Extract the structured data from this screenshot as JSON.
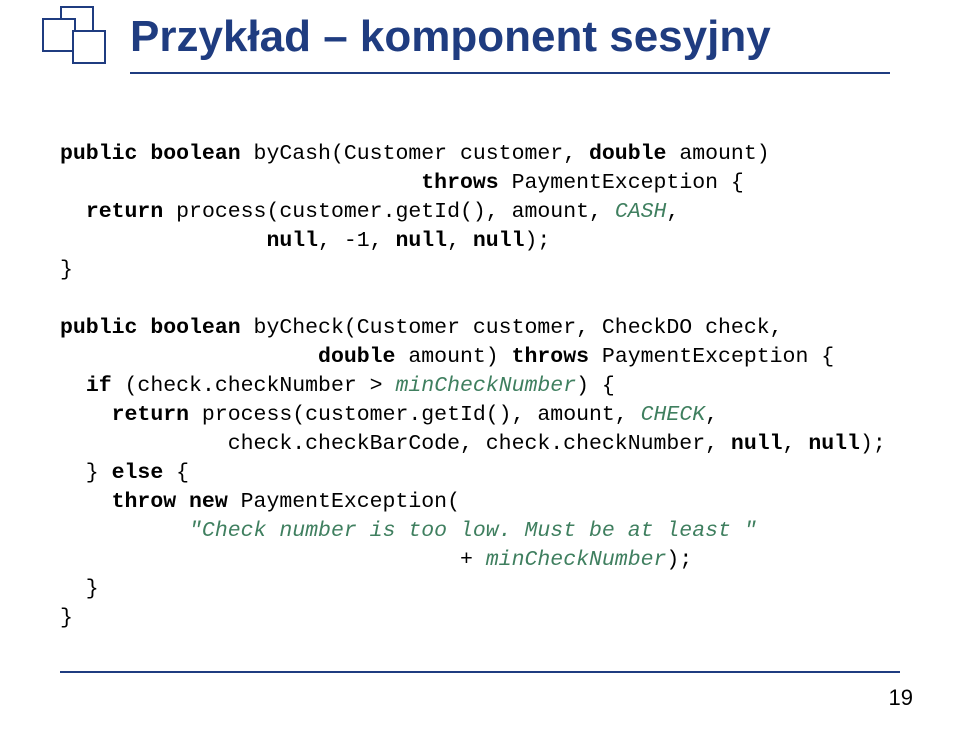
{
  "title": "Przykład – komponent sesyjny",
  "page_number": "19",
  "code": {
    "l1_a": "public boolean",
    "l1_b": " byCash(Customer customer, ",
    "l1_c": "double",
    "l1_d": " amount)",
    "l2_a": "                            ",
    "l2_b": "throws",
    "l2_c": " PaymentException {",
    "l3_a": "  ",
    "l3_b": "return",
    "l3_c": " process(customer.getId(), amount, ",
    "l3_d": "CASH",
    "l3_e": ",",
    "l4_a": "                ",
    "l4_b": "null",
    "l4_c": ", -1, ",
    "l4_d": "null",
    "l4_e": ", ",
    "l4_f": "null",
    "l4_g": ");",
    "l5": "}",
    "blank": "",
    "l6_a": "public boolean",
    "l6_b": " byCheck(Customer customer, CheckDO check,",
    "l7_a": "                    ",
    "l7_b": "double",
    "l7_c": " amount) ",
    "l7_d": "throws",
    "l7_e": " PaymentException {",
    "l8_a": "  ",
    "l8_b": "if",
    "l8_c": " (check.checkNumber > ",
    "l8_d": "minCheckNumber",
    "l8_e": ") {",
    "l9_a": "    ",
    "l9_b": "return",
    "l9_c": " process(customer.getId(), amount, ",
    "l9_d": "CHECK",
    "l9_e": ",",
    "l10_a": "             check.checkBarCode, check.checkNumber, ",
    "l10_b": "null",
    "l10_c": ", ",
    "l10_d": "null",
    "l10_e": ");",
    "l11_a": "  } ",
    "l11_b": "else",
    "l11_c": " {",
    "l12_a": "    ",
    "l12_b": "throw new",
    "l12_c": " PaymentException(",
    "l13_a": "          ",
    "l13_b": "\"Check number is too low. Must be at least \"",
    "l14_a": "                               + ",
    "l14_b": "minCheckNumber",
    "l14_c": ");",
    "l15": "  }",
    "l16": "}"
  }
}
